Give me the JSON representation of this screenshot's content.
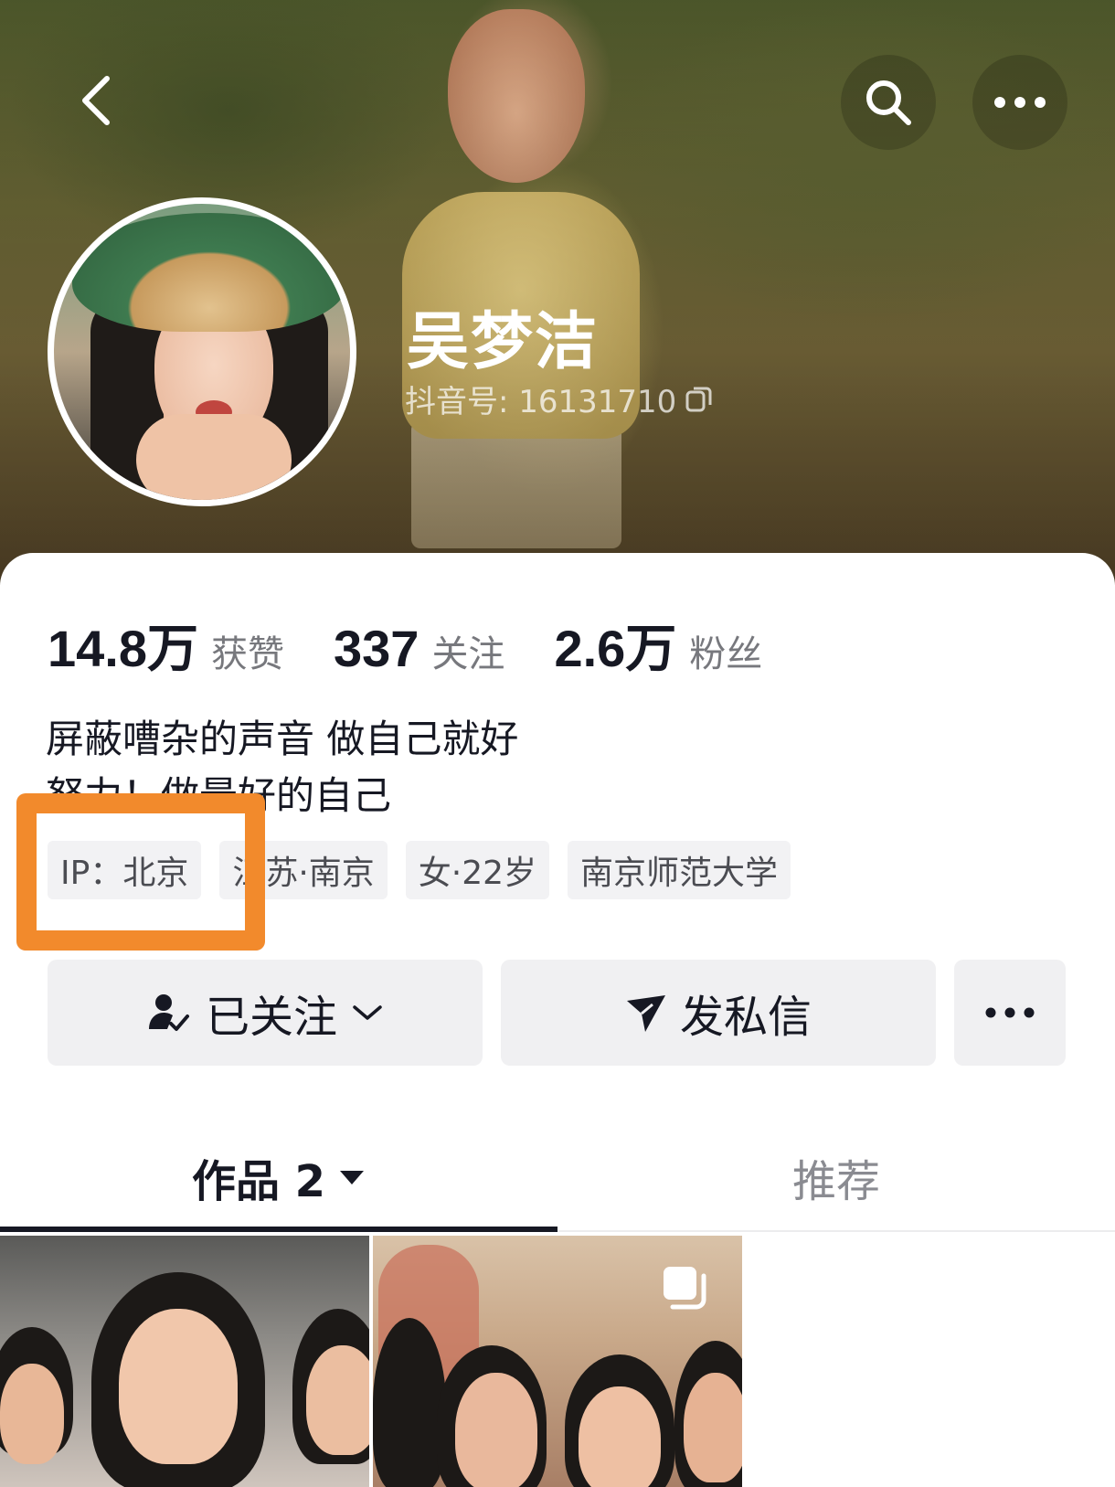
{
  "profile": {
    "name": "吴梦洁",
    "douyin_id_label": "抖音号: 16131710"
  },
  "stats": [
    {
      "value": "14.8万",
      "label": "获赞"
    },
    {
      "value": "337",
      "label": "关注"
    },
    {
      "value": "2.6万",
      "label": "粉丝"
    }
  ],
  "bio": {
    "line1": "屏蔽嘈杂的声音 做自己就好",
    "line2": "努力！做最好的自己"
  },
  "tags": {
    "ip": "IP：北京",
    "location": "江苏·南京",
    "gender_age": "女·22岁",
    "school": "南京师范大学"
  },
  "actions": {
    "follow_label": "已关注",
    "message_label": "发私信"
  },
  "tabs": {
    "works_label": "作品 2",
    "recommend_label": "推荐"
  },
  "colors": {
    "highlight": "#f28a2c",
    "text_primary": "#161823",
    "text_secondary": "#77787d"
  },
  "icons": [
    "back-icon",
    "search-icon",
    "more-icon",
    "copy-icon",
    "followed-user-icon",
    "chevron-down-icon",
    "send-icon",
    "more-dots-icon",
    "triangle-down-icon",
    "multi-image-icon"
  ]
}
